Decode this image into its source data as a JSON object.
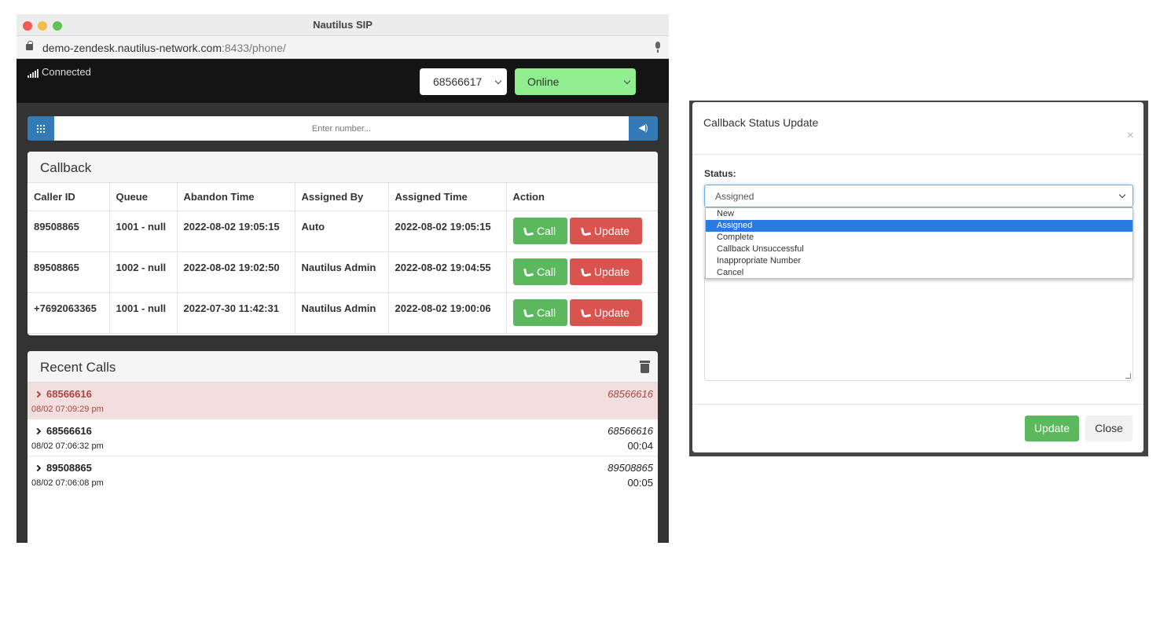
{
  "window": {
    "title": "Nautilus SIP"
  },
  "address": {
    "host": "demo-zendesk.nautilus-network.com",
    "port_path": ":8433/phone/"
  },
  "topbar": {
    "connection": "Connected",
    "extension": "68566617",
    "status": "Online"
  },
  "dialer": {
    "placeholder": "Enter number..."
  },
  "callback": {
    "title": "Callback",
    "headers": [
      "Caller ID",
      "Queue",
      "Abandon Time",
      "Assigned By",
      "Assigned Time",
      "Action"
    ],
    "rows": [
      {
        "caller_id": "89508865",
        "queue": "1001 - null",
        "abandon_time": "2022-08-02 19:05:15",
        "assigned_by": "Auto",
        "assigned_time": "2022-08-02 19:05:15"
      },
      {
        "caller_id": "89508865",
        "queue": "1002 - null",
        "abandon_time": "2022-08-02 19:02:50",
        "assigned_by": "Nautilus Admin",
        "assigned_time": "2022-08-02 19:04:55"
      },
      {
        "caller_id": "+7692063365",
        "queue": "1001 - null",
        "abandon_time": "2022-07-30 11:42:31",
        "assigned_by": "Nautilus Admin",
        "assigned_time": "2022-08-02 19:00:06"
      }
    ],
    "call_label": "Call",
    "update_label": "Update"
  },
  "recent": {
    "title": "Recent Calls",
    "items": [
      {
        "number": "68566616",
        "time": "08/02 07:09:29 pm",
        "right": "68566616",
        "duration": "",
        "missed": true
      },
      {
        "number": "68566616",
        "time": "08/02 07:06:32 pm",
        "right": "68566616",
        "duration": "00:04",
        "missed": false
      },
      {
        "number": "89508865",
        "time": "08/02 07:06:08 pm",
        "right": "89508865",
        "duration": "00:05",
        "missed": false
      }
    ]
  },
  "modal": {
    "title": "Callback Status Update",
    "close_glyph": "×",
    "status_label": "Status:",
    "selected": "Assigned",
    "options": [
      "New",
      "Assigned",
      "Complete",
      "Callback Unsuccessful",
      "Inappropriate Number",
      "Cancel"
    ],
    "update_label": "Update",
    "close_label": "Close"
  }
}
